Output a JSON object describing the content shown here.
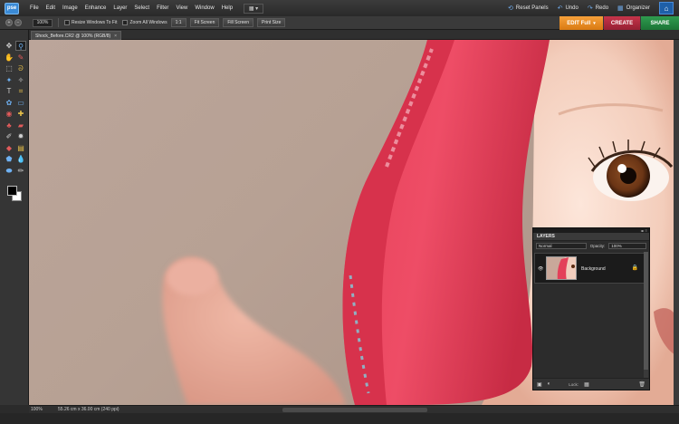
{
  "app": {
    "logo_text": "pse"
  },
  "menubar": {
    "items": [
      "File",
      "Edit",
      "Image",
      "Enhance",
      "Layer",
      "Select",
      "Filter",
      "View",
      "Window",
      "Help"
    ],
    "workspace_icon": "arrange-layout-icon",
    "commands": [
      {
        "label": "Reset Panels",
        "icon": "reset-panels-icon",
        "glyph": "⟲"
      },
      {
        "label": "Undo",
        "icon": "undo-icon",
        "glyph": "↶"
      },
      {
        "label": "Redo",
        "icon": "redo-icon",
        "glyph": "↷"
      },
      {
        "label": "Organizer",
        "icon": "organizer-icon",
        "glyph": "▦"
      }
    ],
    "home_icon": "home-icon"
  },
  "options_bar": {
    "zoom_value": "100%",
    "resize_windows_label": "Resize Windows To Fit",
    "zoom_all_windows_label": "Zoom All Windows",
    "one_to_one_label": "1:1",
    "fit_screen_label": "Fit Screen",
    "fill_screen_label": "Fill Screen",
    "print_size_label": "Print Size"
  },
  "mode_tabs": {
    "edit_label": "EDIT Full",
    "create_label": "CREATE",
    "share_label": "SHARE"
  },
  "document": {
    "tab_title": "Shock_Before.CR2 @ 100% (RGB/8)",
    "close_glyph": "×"
  },
  "toolbox": {
    "tools": [
      {
        "name": "move-tool-icon",
        "glyph": "✥",
        "cls": ""
      },
      {
        "name": "zoom-tool-icon",
        "glyph": "⚲",
        "cls": "c1 active"
      },
      {
        "name": "hand-tool-icon",
        "glyph": "✋",
        "cls": ""
      },
      {
        "name": "eyedropper-tool-icon",
        "glyph": "✎",
        "cls": "c3"
      },
      {
        "name": "marquee-tool-icon",
        "glyph": "⬚",
        "cls": ""
      },
      {
        "name": "lasso-tool-icon",
        "glyph": "ᘐ",
        "cls": "c2"
      },
      {
        "name": "magic-wand-tool-icon",
        "glyph": "✦",
        "cls": "c1"
      },
      {
        "name": "quick-selection-tool-icon",
        "glyph": "✧",
        "cls": ""
      },
      {
        "name": "type-tool-icon",
        "glyph": "T",
        "cls": ""
      },
      {
        "name": "crop-tool-icon",
        "glyph": "⌗",
        "cls": "c2"
      },
      {
        "name": "cookie-cutter-tool-icon",
        "glyph": "✿",
        "cls": "c1"
      },
      {
        "name": "straighten-tool-icon",
        "glyph": "▭",
        "cls": "c1"
      },
      {
        "name": "red-eye-tool-icon",
        "glyph": "◉",
        "cls": "c3"
      },
      {
        "name": "spot-healing-tool-icon",
        "glyph": "✚",
        "cls": "c2"
      },
      {
        "name": "clone-stamp-tool-icon",
        "glyph": "♣",
        "cls": "c3"
      },
      {
        "name": "eraser-tool-icon",
        "glyph": "▰",
        "cls": "c3"
      },
      {
        "name": "brush-tool-icon",
        "glyph": "✐",
        "cls": ""
      },
      {
        "name": "smart-brush-tool-icon",
        "glyph": "✹",
        "cls": ""
      },
      {
        "name": "paint-bucket-tool-icon",
        "glyph": "◆",
        "cls": "c3"
      },
      {
        "name": "gradient-tool-icon",
        "glyph": "▤",
        "cls": "c2"
      },
      {
        "name": "shape-tool-icon",
        "glyph": "⬟",
        "cls": "c1"
      },
      {
        "name": "blur-tool-icon",
        "glyph": "💧",
        "cls": "c1"
      },
      {
        "name": "sponge-tool-icon",
        "glyph": "⬬",
        "cls": "c1"
      },
      {
        "name": "pencil-tool-icon",
        "glyph": "✏",
        "cls": ""
      }
    ],
    "foreground_color": "#000000",
    "background_color": "#ffffff"
  },
  "status_bar": {
    "zoom": "100%",
    "doc_info": "55.26 cm x 36.00 cm (240 ppi)"
  },
  "layers_panel": {
    "title": "LAYERS",
    "blend_mode": "Normal",
    "opacity_label": "Opacity:",
    "opacity_value": "100%",
    "layer_name": "Background",
    "lock_label": "Lock:"
  },
  "colors": {
    "edit_accent": "#e98a20",
    "create_accent": "#b22a3f",
    "share_accent": "#268442"
  }
}
